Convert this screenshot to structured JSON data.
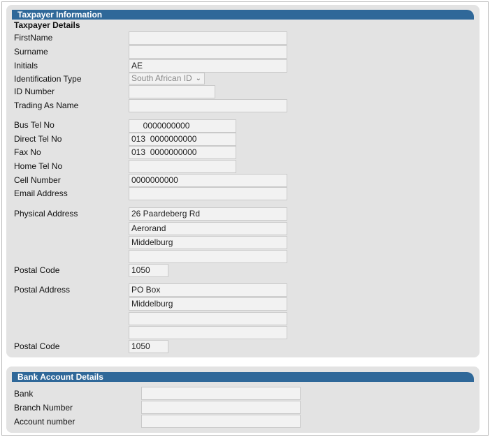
{
  "taxpayer_panel": {
    "header": "Taxpayer Information",
    "subheading": "Taxpayer Details",
    "labels": {
      "first_name": "FirstName",
      "surname": "Surname",
      "initials": "Initials",
      "identification_type": "Identification Type",
      "id_number": "ID Number",
      "trading_as_name": "Trading As Name",
      "bus_tel_no": "Bus Tel No",
      "direct_tel_no": "Direct Tel No",
      "fax_no": "Fax No",
      "home_tel_no": "Home Tel No",
      "cell_number": "Cell Number",
      "email_address": "Email Address",
      "physical_address": "Physical Address",
      "postal_code_1": "Postal Code",
      "postal_address": "Postal Address",
      "postal_code_2": "Postal Code"
    },
    "values": {
      "first_name": "",
      "surname": "",
      "initials": "AE",
      "identification_type": "South African ID",
      "id_number": "",
      "trading_as_name": "",
      "bus_tel_no": "     0000000000",
      "direct_tel_no": "013  0000000000",
      "fax_no": "013  0000000000",
      "home_tel_no": "",
      "cell_number": "0000000000",
      "email_address": "",
      "physical_address_line1": "26 Paardeberg Rd",
      "physical_address_line2": "Aerorand",
      "physical_address_line3": "Middelburg",
      "physical_address_line4": "",
      "postal_code_1": "1050",
      "postal_address_line1": "PO Box",
      "postal_address_line2": "Middelburg",
      "postal_address_line3": "",
      "postal_address_line4": "",
      "postal_code_2": "1050"
    }
  },
  "bank_panel": {
    "header": "Bank Account Details",
    "labels": {
      "bank": "Bank",
      "branch_number": "Branch Number",
      "account_number": "Account number"
    },
    "values": {
      "bank": "",
      "branch_number": "",
      "account_number": ""
    }
  },
  "colors": {
    "header_bg": "#2f6899",
    "panel_bg": "#e3e3e3",
    "field_bg": "#f2f2f2"
  },
  "icons": {
    "select_arrow": "chevron-down-icon"
  }
}
